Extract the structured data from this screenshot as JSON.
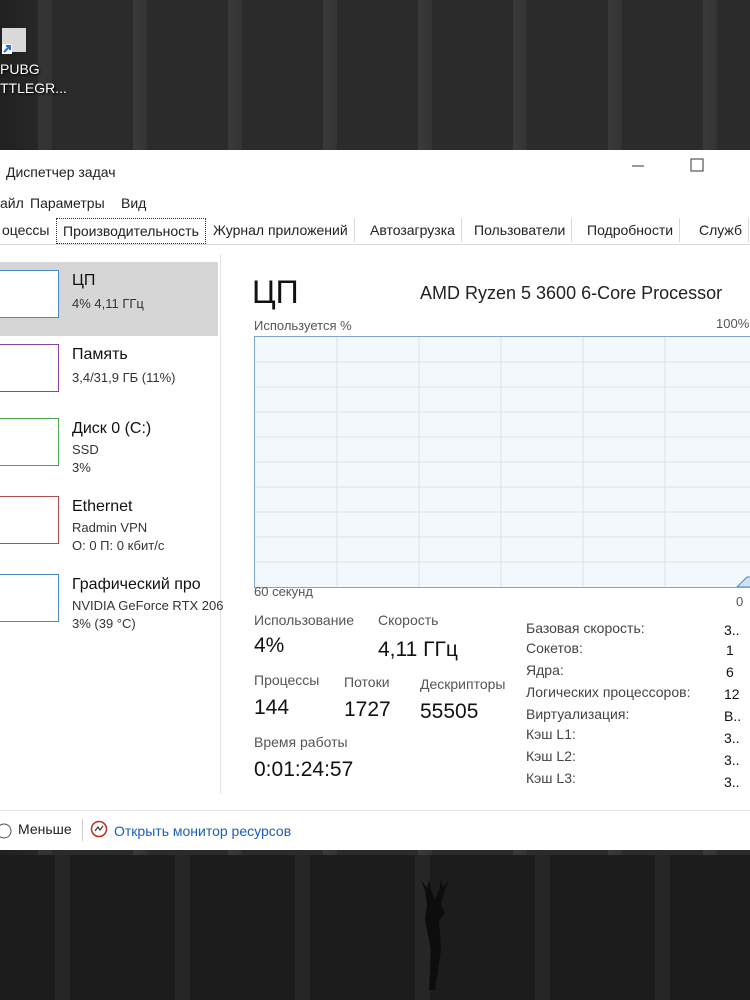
{
  "desktop": {
    "icon_label": "PUBG\nTTLEGR..."
  },
  "window": {
    "title": "Диспетчер задач"
  },
  "menu": {
    "file": "айл",
    "options": "Параметры",
    "view": "Вид"
  },
  "tabs": [
    {
      "label": "оцессы"
    },
    {
      "label": "Производительность"
    },
    {
      "label": "Журнал приложений"
    },
    {
      "label": "Автозагрузка"
    },
    {
      "label": "Пользователи"
    },
    {
      "label": "Подробности"
    },
    {
      "label": "Служб"
    }
  ],
  "resources": [
    {
      "name": "ЦП",
      "line1": "4% 4,11 ГГц",
      "line2": "",
      "color": "#4a8ac9"
    },
    {
      "name": "Память",
      "line1": "3,4/31,9 ГБ (11%)",
      "line2": "",
      "color": "#8b3fa8"
    },
    {
      "name": "Диск 0 (C:)",
      "line1": "SSD",
      "line2": "3%",
      "color": "#4ca64c"
    },
    {
      "name": "Ethernet",
      "line1": "Radmin VPN",
      "line2": "О: 0 П: 0 кбит/с",
      "color": "#b05050"
    },
    {
      "name": "Графический про",
      "line1": "NVIDIA GeForce RTX 206",
      "line2": "3% (39 °C)",
      "color": "#4a8ac9"
    }
  ],
  "detail": {
    "title": "ЦП",
    "model": "AMD Ryzen 5 3600 6-Core Processor",
    "graph_label": "Используется %",
    "graph_max": "100%",
    "graph_time": "60 секунд",
    "graph_min": "0",
    "graph_level": 0.04,
    "usage_label": "Использование",
    "usage_value": "4%",
    "speed_label": "Скорость",
    "speed_value": "4,11 ГГц",
    "processes_label": "Процессы",
    "processes_value": "144",
    "threads_label": "Потоки",
    "threads_value": "1727",
    "handles_label": "Дескрипторы",
    "handles_value": "55505",
    "uptime_label": "Время работы",
    "uptime_value": "0:01:24:57",
    "props": [
      {
        "label": "Базовая скорость:",
        "value": "3.."
      },
      {
        "label": "Сокетов:",
        "value": "1"
      },
      {
        "label": "Ядра:",
        "value": "6"
      },
      {
        "label": "Логических процессоров:",
        "value": "12"
      },
      {
        "label": "Виртуализация:",
        "value": "В.."
      },
      {
        "label": "Кэш L1:",
        "value": "3.."
      },
      {
        "label": "Кэш L2:",
        "value": "3.."
      },
      {
        "label": "Кэш L3:",
        "value": "3.."
      }
    ]
  },
  "footer": {
    "fewer": "Меньше",
    "monitor": "Открыть монитор ресурсов"
  }
}
